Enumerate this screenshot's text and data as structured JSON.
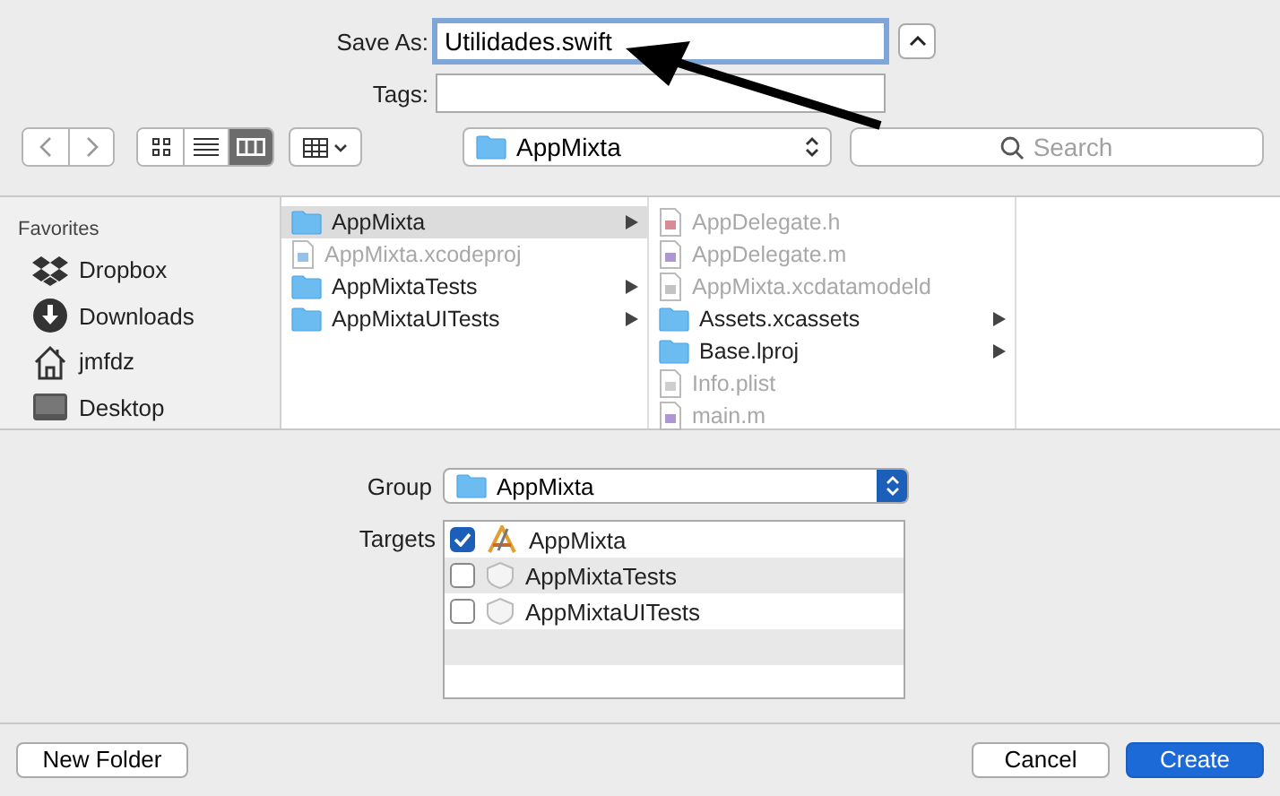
{
  "save_as": {
    "label": "Save As:",
    "value": "Utilidades.swift"
  },
  "tags": {
    "label": "Tags:"
  },
  "view_modes": [
    {
      "kind": "icons",
      "selected": false
    },
    {
      "kind": "list",
      "selected": false
    },
    {
      "kind": "columns",
      "selected": true
    }
  ],
  "location": {
    "value": "AppMixta"
  },
  "search": {
    "placeholder": "Search"
  },
  "sidebar": {
    "heading": "Favorites",
    "items": [
      {
        "label": "Dropbox",
        "kind": "dropbox"
      },
      {
        "label": "Downloads",
        "kind": "downloads"
      },
      {
        "label": "jmfdz",
        "kind": "home"
      },
      {
        "label": "Desktop",
        "kind": "desktop"
      }
    ]
  },
  "columns": [
    {
      "items": [
        {
          "name": "AppMixta",
          "kind": "folder",
          "selected": true,
          "disabled": false,
          "expandable": true
        },
        {
          "name": "AppMixta.xcodeproj",
          "kind": "project",
          "selected": false,
          "disabled": true,
          "expandable": false
        },
        {
          "name": "AppMixtaTests",
          "kind": "folder",
          "selected": false,
          "disabled": false,
          "expandable": true
        },
        {
          "name": "AppMixtaUITests",
          "kind": "folder",
          "selected": false,
          "disabled": false,
          "expandable": true
        }
      ]
    },
    {
      "items": [
        {
          "name": "AppDelegate.h",
          "kind": "header",
          "selected": false,
          "disabled": true,
          "expandable": false
        },
        {
          "name": "AppDelegate.m",
          "kind": "source",
          "selected": false,
          "disabled": true,
          "expandable": false
        },
        {
          "name": "AppMixta.xcdatamodeld",
          "kind": "model",
          "selected": false,
          "disabled": true,
          "expandable": false
        },
        {
          "name": "Assets.xcassets",
          "kind": "folder",
          "selected": false,
          "disabled": false,
          "expandable": true
        },
        {
          "name": "Base.lproj",
          "kind": "folder",
          "selected": false,
          "disabled": false,
          "expandable": true
        },
        {
          "name": "Info.plist",
          "kind": "plist",
          "selected": false,
          "disabled": true,
          "expandable": false
        },
        {
          "name": "main.m",
          "kind": "source",
          "selected": false,
          "disabled": true,
          "expandable": false
        }
      ]
    }
  ],
  "group": {
    "label": "Group",
    "value": "AppMixta"
  },
  "targets": {
    "label": "Targets",
    "items": [
      {
        "name": "AppMixta",
        "kind": "app",
        "checked": true
      },
      {
        "name": "AppMixtaTests",
        "kind": "test",
        "checked": false
      },
      {
        "name": "AppMixtaUITests",
        "kind": "test",
        "checked": false
      }
    ]
  },
  "buttons": {
    "new_folder": "New Folder",
    "cancel": "Cancel",
    "create": "Create"
  }
}
